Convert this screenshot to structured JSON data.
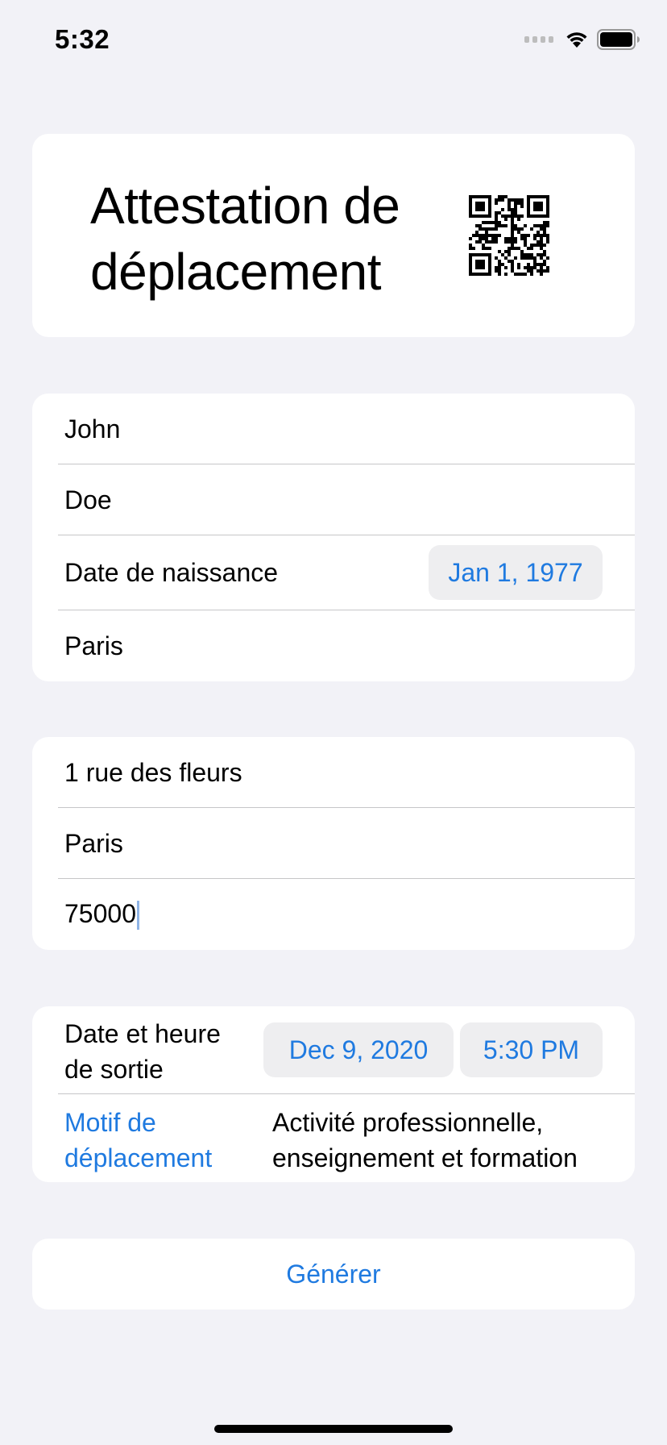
{
  "status_bar": {
    "time": "5:32"
  },
  "header": {
    "title": "Attestation de\ndéplacement",
    "qr_icon": "qr-code-icon"
  },
  "identity": {
    "first_name": "John",
    "last_name": "Doe",
    "birth_label": "Date de naissance",
    "birth_date": "Jan 1, 1977",
    "birth_place": "Paris"
  },
  "address": {
    "street": "1 rue des fleurs",
    "city": "Paris",
    "postal_code": "75000"
  },
  "trip": {
    "datetime_label": "Date et heure\nde sortie",
    "date": "Dec 9, 2020",
    "time": "5:30 PM",
    "reason_label": "Motif de\ndéplacement",
    "reason_value": "Activité professionnelle,\nenseignement et formation"
  },
  "actions": {
    "generate": "Générer"
  },
  "colors": {
    "accent": "#1f7ae0",
    "background": "#f2f2f7",
    "card": "#ffffff"
  }
}
